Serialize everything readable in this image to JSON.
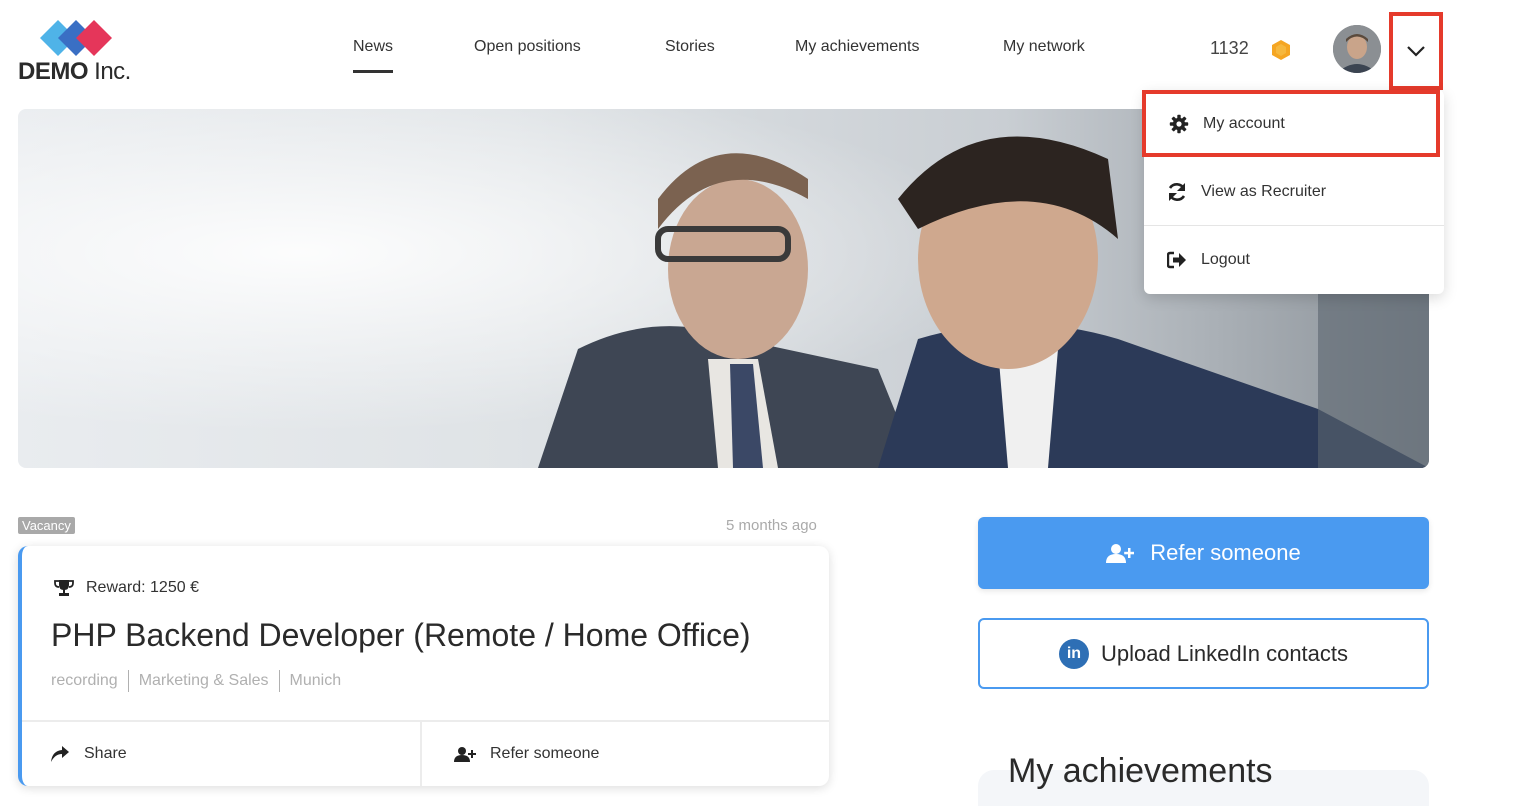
{
  "brand": {
    "logo_bold": "DEMO",
    "logo_thin": " Inc."
  },
  "nav": {
    "items": [
      {
        "label": "News",
        "active": true
      },
      {
        "label": "Open positions",
        "active": false
      },
      {
        "label": "Stories",
        "active": false
      },
      {
        "label": "My achievements",
        "active": false
      },
      {
        "label": "My network",
        "active": false
      }
    ]
  },
  "user": {
    "points": "1132",
    "coin_icon": "hexagon-coin-icon"
  },
  "account_menu": {
    "items": [
      {
        "label": "My account",
        "icon": "gear-icon"
      },
      {
        "label": "View as Recruiter",
        "icon": "sync-icon"
      },
      {
        "label": "Logout",
        "icon": "sign-out-icon"
      }
    ]
  },
  "feed": {
    "badge": "Vacancy",
    "time_ago": "5 months ago",
    "job": {
      "reward": "Reward: 1250 €",
      "title": "PHP Backend Developer (Remote / Home Office)",
      "tags": [
        "recording",
        "Marketing & Sales",
        "Munich"
      ],
      "share_label": "Share",
      "refer_label": "Refer someone"
    }
  },
  "sidebar": {
    "refer_button": "Refer someone",
    "linkedin_button": "Upload LinkedIn contacts",
    "linkedin_icon_text": "in",
    "achievements_title": "My achievements"
  },
  "colors": {
    "primary": "#4a9af0",
    "highlight": "#e53a2b",
    "coin": "#f5a623",
    "linkedin": "#2e6fb5"
  }
}
